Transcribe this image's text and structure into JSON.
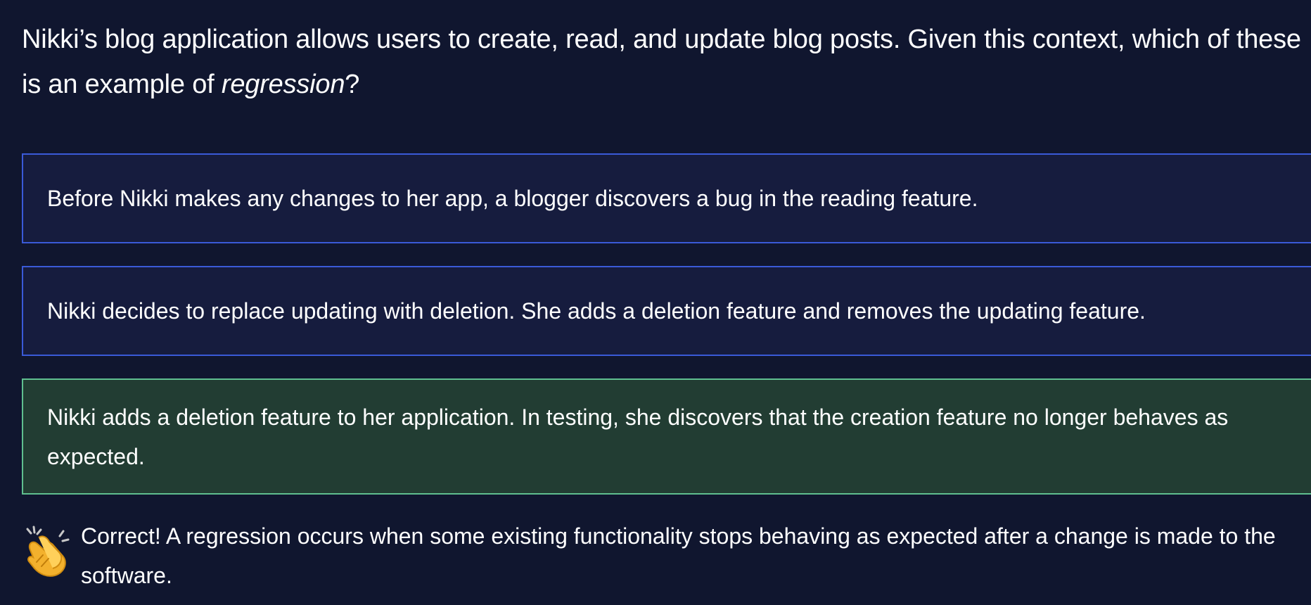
{
  "question": {
    "text_before": "Nikki’s blog application allows users to create, read, and update blog posts. Given this context, which of these is an example of ",
    "emphasis": "regression",
    "text_after": "?"
  },
  "options": [
    {
      "label": "Before Nikki makes any changes to her app, a blogger discovers a bug in the reading feature.",
      "state": "unselected"
    },
    {
      "label": "Nikki decides to replace updating with deletion. She adds a deletion feature and removes the updating feature.",
      "state": "unselected"
    },
    {
      "label": "Nikki adds a deletion feature to her application. In testing, she discovers that the creation feature no longer behaves as expected.",
      "state": "correct"
    }
  ],
  "feedback": {
    "icon": "clapping-hands-icon",
    "text": "Correct! A regression occurs when some existing functionality stops behaving as expected after a change is made to the software."
  },
  "colors": {
    "background": "#10162f",
    "option_border": "#3a5ad8",
    "correct_background": "#223d33",
    "correct_border": "#5fbf8f"
  }
}
